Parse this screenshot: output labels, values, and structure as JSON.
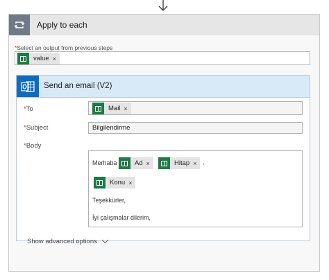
{
  "apply_each": {
    "title": "Apply to each",
    "select_label": "Select an output from previous steps",
    "required_mark": "*",
    "token": {
      "label": "value",
      "remove": "×",
      "icon": "excel-icon"
    }
  },
  "email": {
    "title": "Send an email (V2)",
    "fields": {
      "to": {
        "label": "To",
        "token": {
          "label": "Mail",
          "remove": "×"
        }
      },
      "subject": {
        "label": "Subject",
        "value": "Bilgilendirme"
      },
      "body": {
        "label": "Body",
        "greeting": "Merhaba",
        "tokens": [
          {
            "label": "Ad",
            "remove": "×"
          },
          {
            "label": "Hitap",
            "remove": "×"
          },
          {
            "label": "Konu",
            "remove": "×"
          }
        ],
        "comma": ",",
        "line1": "Teşekkürler,",
        "line2": "İyi çalışmalar dilerim,"
      }
    },
    "show_advanced": "Show advanced options"
  },
  "colors": {
    "excel_green": "#1e7a45",
    "outlook_blue": "#0f6cbd",
    "header_blue": "#d8e9f8",
    "loop_gray": "#6e7b86"
  }
}
